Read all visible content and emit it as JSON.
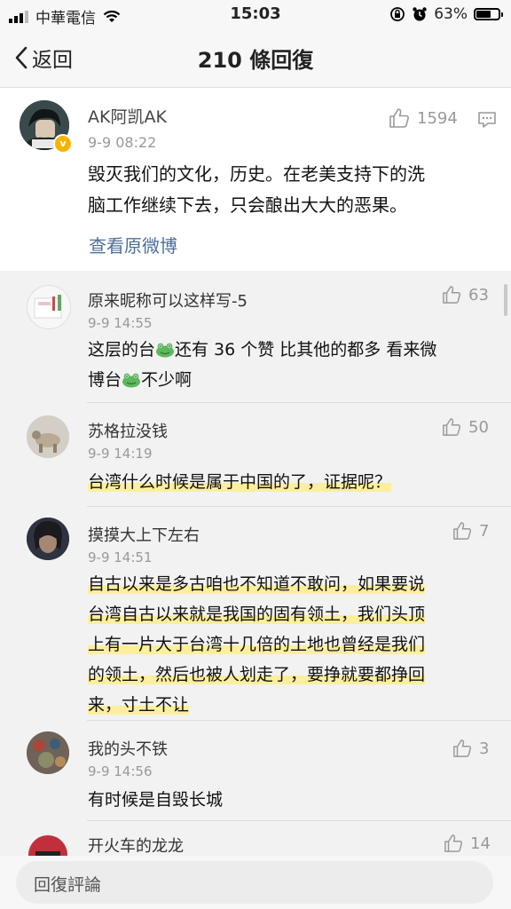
{
  "status": {
    "carrier": "中華電信",
    "time": "15:03",
    "battery": "63%"
  },
  "nav": {
    "back": "返回",
    "title": "210 條回復"
  },
  "post": {
    "user": "AK阿凯AK",
    "time": "9-9 08:22",
    "likes": "1594",
    "avatar_label": "阿凯",
    "verified_mark": "v",
    "lines": [
      "毁灭我们的文化，历史。在老美支持下的洗",
      "脑工作继续下去，只会酿出大大的恶果。"
    ],
    "link": "查看原微博"
  },
  "replies": [
    {
      "user": "原来昵称可以这样写-5",
      "time": "9-9 14:55",
      "likes": "63",
      "line1_a": "这层的台",
      "line1_b": "还有 36 个赞 比其他的都多 看来微",
      "line2_a": "博台",
      "line2_b": "不少啊"
    },
    {
      "user": "苏格拉没钱",
      "time": "9-9 14:19",
      "likes": "50",
      "lines": [
        "台湾什么时候是属于中国的了，证据呢？"
      ]
    },
    {
      "user": "摸摸大上下左右",
      "time": "9-9 14:51",
      "likes": "7",
      "lines": [
        "自古以来是多古咱也不知道不敢问，如果要说",
        "台湾自古以来就是我国的固有领土，我们头顶",
        "上有一片大于台湾十几倍的土地也曾经是我们",
        "的领土，然后也被人划走了，要挣就要都挣回",
        "来，寸土不让"
      ]
    },
    {
      "user": "我的头不铁",
      "time": "9-9 14:56",
      "likes": "3",
      "lines": [
        "有时候是自毁长城"
      ]
    },
    {
      "user": "开火车的龙龙",
      "likes": "14"
    }
  ],
  "input": {
    "placeholder": "回復評論"
  },
  "colors": {
    "link": "#4d6f9a",
    "highlight": "#ffee8c",
    "verified": "#f5b400"
  },
  "icons": [
    "cellular-signal-icon",
    "wifi-icon",
    "rotation-lock-icon",
    "alarm-icon",
    "battery-icon",
    "back-chevron-icon",
    "thumbs-up-icon",
    "comment-icon",
    "frog-emoji-icon"
  ]
}
